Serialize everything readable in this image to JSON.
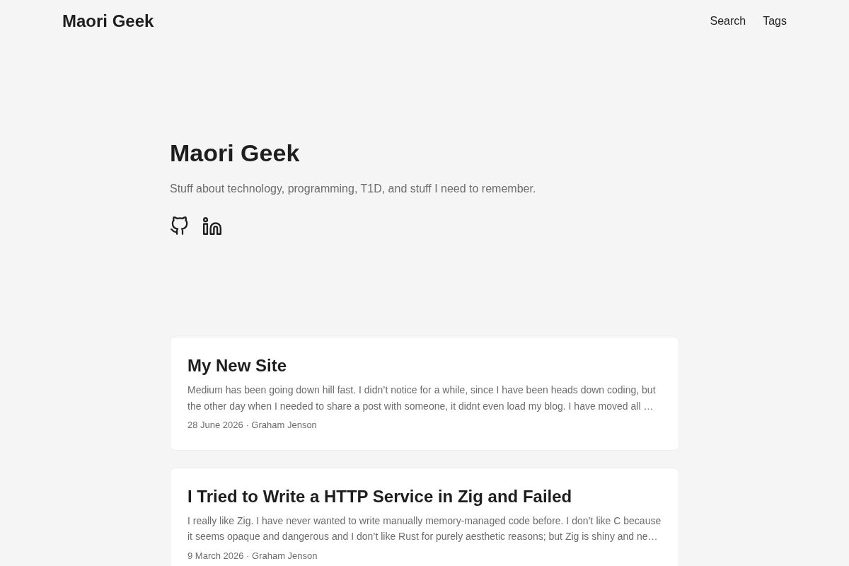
{
  "header": {
    "logo": "Maori Geek",
    "menu": [
      "Search",
      "Tags"
    ]
  },
  "intro": {
    "title": "Maori Geek",
    "tagline": "Stuff about technology, programming, T1D, and stuff I need to remember.",
    "social_links": [
      {
        "kind": "github"
      },
      {
        "kind": "linkedin"
      }
    ]
  },
  "posts": [
    {
      "title": "My New Site",
      "summary": "Medium has been going down hill fast. I didn’t notice for a while, since I have been heads down coding, but the other day when I needed to share a post with someone, it didnt even load my blog. I have moved all …",
      "meta": "28 June 2026 · Graham Jenson"
    },
    {
      "title": "I Tried to Write a HTTP Service in Zig and Failed",
      "summary": "I really like Zig. I have never wanted to write manually memory-managed code before. I don’t like C because it seems opaque and dangerous and I don’t like Rust for purely aesthetic reasons; but Zig is shiny and ne…",
      "meta": "9 March 2026 · Graham Jenson"
    }
  ]
}
